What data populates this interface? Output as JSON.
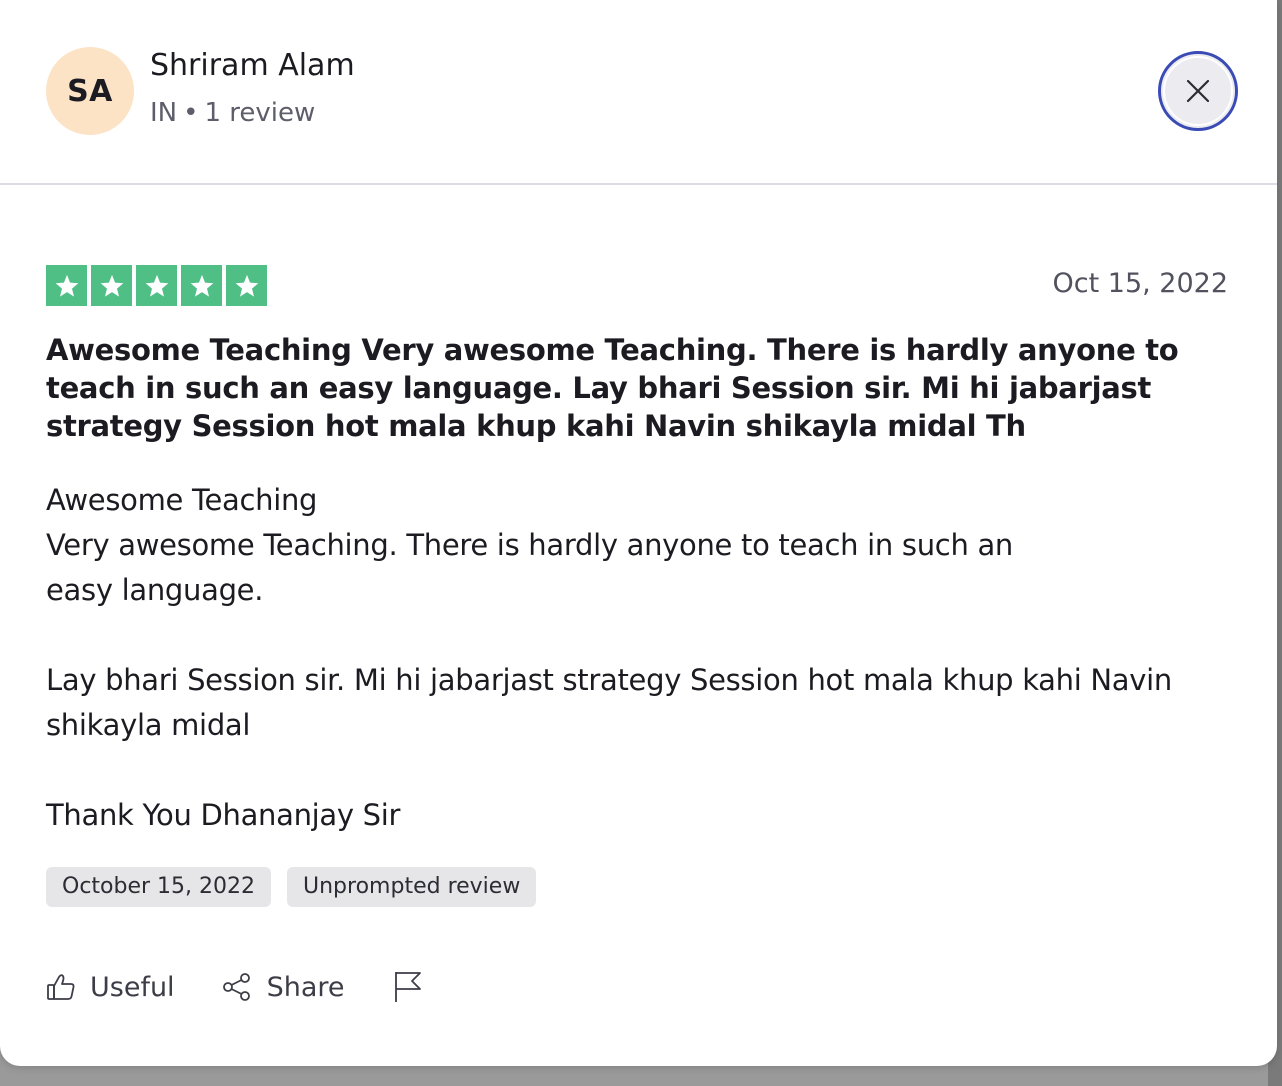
{
  "reviewer": {
    "initials": "SA",
    "name": "Shriram Alam",
    "country": "IN",
    "separator": "•",
    "review_count": "1 review",
    "avatar_color": "#fce3c5"
  },
  "review": {
    "rating": 5,
    "star_color": "#4fbf86",
    "date_short": "Oct 15, 2022",
    "title": "Awesome Teaching Very awesome Teaching. There is hardly anyone to teach in such an easy language. Lay bhari Session sir. Mi hi jabarjast strategy Session hot mala khup kahi Navin shikayla midal Th",
    "body": "Awesome Teaching\nVery awesome Teaching. There is hardly anyone to teach in such an\neasy language.\n\nLay bhari Session sir. Mi hi jabarjast strategy Session hot mala khup kahi Navin shikayla midal\n\nThank You Dhananjay Sir",
    "tags": {
      "date_long": "October 15, 2022",
      "type": "Unprompted review"
    }
  },
  "actions": {
    "useful_label": "Useful",
    "share_label": "Share",
    "useful_icon": "thumbs-up-icon",
    "share_icon": "share-icon",
    "report_icon": "flag-icon"
  },
  "close": {
    "icon": "close-icon",
    "focus_ring_color": "#3a4bb5"
  }
}
